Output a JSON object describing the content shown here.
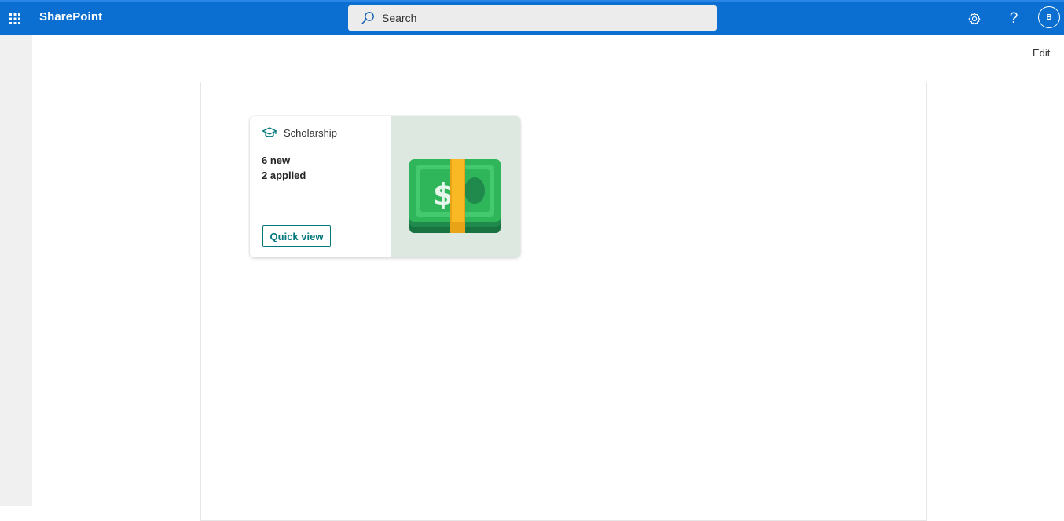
{
  "suitebar": {
    "app_name": "SharePoint",
    "search_placeholder": "Search",
    "avatar_initial": "B",
    "background_color": "#0a6fd0",
    "icons": [
      "waffle-icon",
      "search-icon",
      "settings-icon",
      "help-icon"
    ]
  },
  "page": {
    "edit_label": "Edit"
  },
  "card": {
    "title": "Scholarship",
    "icon": "graduation-cap-icon",
    "line1": "6 new",
    "line2": "2 applied",
    "button_label": "Quick view",
    "image": "money-bills-icon",
    "accent_color": "#03787c",
    "image_background": "#dde8e1"
  }
}
